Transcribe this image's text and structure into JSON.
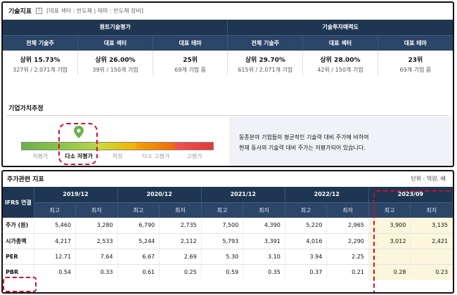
{
  "top": {
    "title": "기술지표",
    "tags": "[대표 섹터 : 반도체 | 테마 : 반도체 장비]",
    "groups": [
      "퀀트기술평가",
      "기술투자매력도"
    ],
    "columns": [
      "전체 기술주",
      "대표 섹터",
      "대표 테마",
      "전체 기술주",
      "대표 섹터",
      "대표 테마"
    ],
    "ranks": [
      "상위 15.73%",
      "상위 26.00%",
      "25위",
      "상위 29.70%",
      "상위 28.00%",
      "23위"
    ],
    "counts": [
      "327위 / 2,071개 기업",
      "39위 / 150개 기업",
      "69개 기업 중",
      "615위 / 2,071개 기업",
      "42위 / 150개 기업",
      "69개 기업 중"
    ]
  },
  "valuation": {
    "title": "기업가치추정",
    "scale": [
      "저평가",
      "다소 저평가",
      "적정",
      "다소 고평가",
      "고평가"
    ],
    "active_index": 1,
    "text_lines": [
      "동종분야 기업들의 평균적인 기술력 대비 주가에 비하여",
      "현재 동사의 기술력 대비 주가는 저평가되어 있습니다."
    ],
    "pin_color": "#6ab04c"
  },
  "price": {
    "title": "주가관련 지표",
    "unit": "단위 : 억원, 배",
    "corner_label": "IFRS 연결",
    "years": [
      "2019/12",
      "2020/12",
      "2021/12",
      "2022/12",
      "2023/09"
    ],
    "subheads": [
      "최고",
      "최저"
    ],
    "rows": [
      {
        "label": "주가 (원)",
        "values": [
          "5,460",
          "3,280",
          "6,790",
          "2,735",
          "7,500",
          "4,390",
          "5,220",
          "2,965",
          "3,900",
          "3,135"
        ]
      },
      {
        "label": "시가총액",
        "values": [
          "4,217",
          "2,533",
          "5,244",
          "2,112",
          "5,793",
          "3,391",
          "4,016",
          "2,290",
          "3,012",
          "2,421"
        ]
      },
      {
        "label": "PER",
        "values": [
          "12.71",
          "7.64",
          "6.67",
          "2.69",
          "5.30",
          "3.10",
          "3.94",
          "2.25",
          "",
          ""
        ]
      },
      {
        "label": "PBR",
        "values": [
          "0.54",
          "0.33",
          "0.61",
          "0.25",
          "0.59",
          "0.35",
          "0.37",
          "0.21",
          "0.28",
          "0.23"
        ]
      }
    ]
  },
  "colors": {
    "header_navy": "#1f3652",
    "highlight_red": "#c8102e",
    "highlight_fill": "#fbf6dc"
  }
}
